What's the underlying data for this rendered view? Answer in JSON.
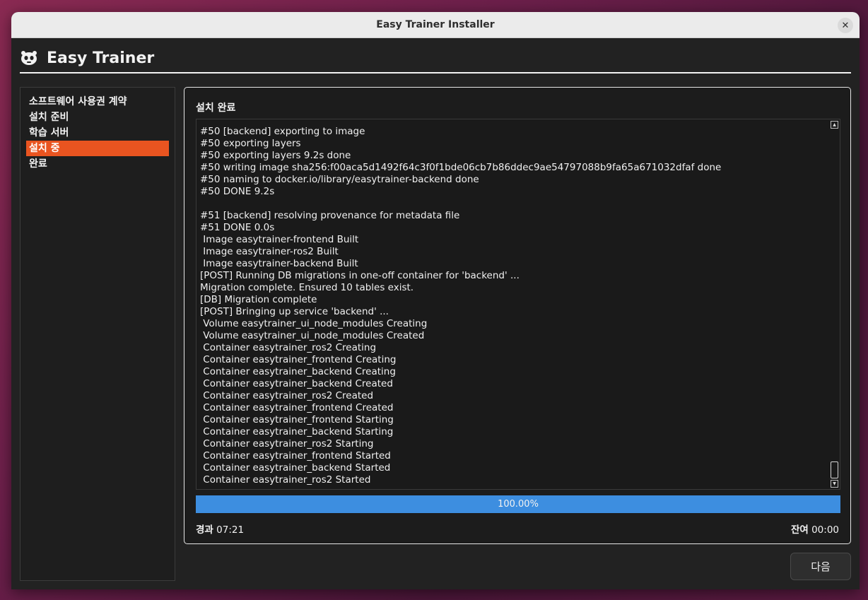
{
  "window": {
    "title": "Easy Trainer Installer",
    "close_glyph": "✕"
  },
  "header": {
    "app_title": "Easy Trainer",
    "logo_icon": "robot-icon"
  },
  "sidebar": {
    "items": [
      {
        "label": "소프트웨어 사용권 계약",
        "active": false
      },
      {
        "label": "설치 준비",
        "active": false
      },
      {
        "label": "학습 서버",
        "active": false
      },
      {
        "label": "설치 중",
        "active": true
      },
      {
        "label": "완료",
        "active": false
      }
    ]
  },
  "panel": {
    "title": "설치 완료",
    "log_lines": [
      "#50 [backend] exporting to image",
      "#50 exporting layers",
      "#50 exporting layers 9.2s done",
      "#50 writing image sha256:f00aca5d1492f64c3f0f1bde06cb7b86ddec9ae54797088b9fa65a671032dfaf done",
      "#50 naming to docker.io/library/easytrainer-backend done",
      "#50 DONE 9.2s",
      "",
      "#51 [backend] resolving provenance for metadata file",
      "#51 DONE 0.0s",
      " Image easytrainer-frontend Built",
      " Image easytrainer-ros2 Built",
      " Image easytrainer-backend Built",
      "[POST] Running DB migrations in one-off container for 'backend' ...",
      "Migration complete. Ensured 10 tables exist.",
      "[DB] Migration complete",
      "[POST] Bringing up service 'backend' ...",
      " Volume easytrainer_ui_node_modules Creating",
      " Volume easytrainer_ui_node_modules Created",
      " Container easytrainer_ros2 Creating",
      " Container easytrainer_frontend Creating",
      " Container easytrainer_backend Creating",
      " Container easytrainer_backend Created",
      " Container easytrainer_ros2 Created",
      " Container easytrainer_frontend Created",
      " Container easytrainer_frontend Starting",
      " Container easytrainer_backend Starting",
      " Container easytrainer_ros2 Starting",
      " Container easytrainer_frontend Started",
      " Container easytrainer_backend Started",
      " Container easytrainer_ros2 Started"
    ],
    "progress": {
      "value": 1.0,
      "text": "100.00%"
    },
    "elapsed_label": "경과",
    "elapsed_value": "07:21",
    "remaining_label": "잔여",
    "remaining_value": "00:00"
  },
  "footer": {
    "next_label": "다음"
  },
  "colors": {
    "accent": "#e95420",
    "progress": "#3d8ee0"
  }
}
